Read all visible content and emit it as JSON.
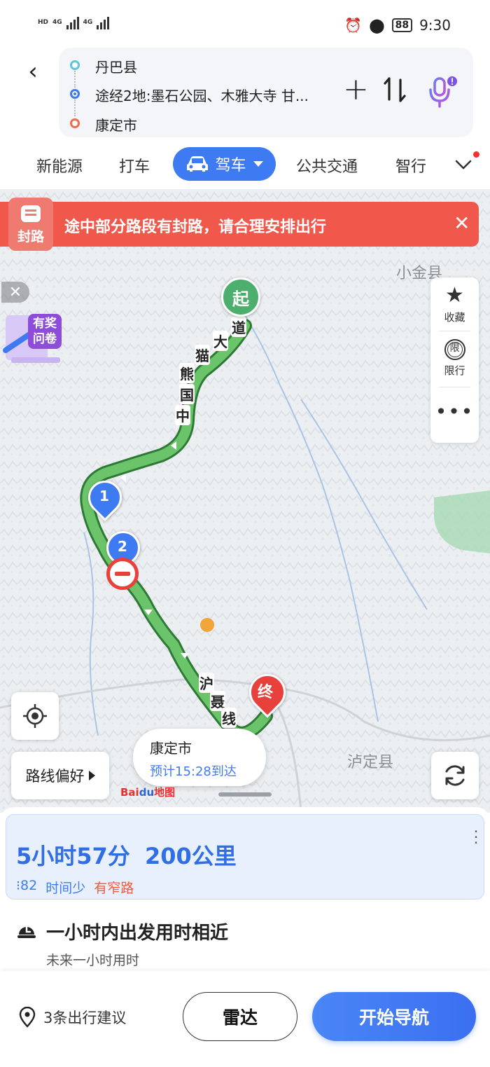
{
  "status_bar": {
    "network_left": [
      "HD",
      "4G",
      "HD",
      "4G"
    ],
    "battery": "88",
    "time": "9:30"
  },
  "route": {
    "start": "丹巴县",
    "waypoints": "途经2地:墨石公园、木雅大寺 甘...",
    "end": "康定市"
  },
  "modes": {
    "new_energy": "新能源",
    "taxi": "打车",
    "drive": "驾车",
    "transit": "公共交通",
    "smart": "智行"
  },
  "closure": {
    "badge": "封路",
    "message": "途中部分路段有封路，请合理安排出行"
  },
  "survey": {
    "label": "有奖问卷"
  },
  "side_panel": {
    "favorite": "收藏",
    "restriction_badge": "限",
    "restriction": "限行"
  },
  "map": {
    "start_marker": "起",
    "end_marker": "终",
    "waypoint_1": "1",
    "waypoint_2": "2",
    "road_label_1": [
      "中",
      "国",
      "熊",
      "猫",
      "大",
      "道"
    ],
    "road_label_2": [
      "沪",
      "聂",
      "线"
    ],
    "place_luding": "泸定县",
    "place_xiaojin": "小金县",
    "dest_name": "康定市",
    "dest_eta": "预计15:28到达",
    "logo_bai": "Bai",
    "logo_du": "du",
    "logo_suffix": "地图",
    "route_preference": "路线偏好"
  },
  "colors": {
    "accent": "#3e7bf3",
    "route": "#5cb85c",
    "closure": "#f0584c",
    "warn": "#f05a3a"
  },
  "summary": {
    "duration": "5小时57分",
    "distance": "200公里",
    "lights": "82",
    "tag_time": "时间少",
    "tag_narrow": "有窄路"
  },
  "departure_hint": {
    "title": "一小时内出发用时相近",
    "subtitle": "未来一小时用时"
  },
  "actions": {
    "suggestions": "3条出行建议",
    "radar": "雷达",
    "start": "开始导航"
  }
}
